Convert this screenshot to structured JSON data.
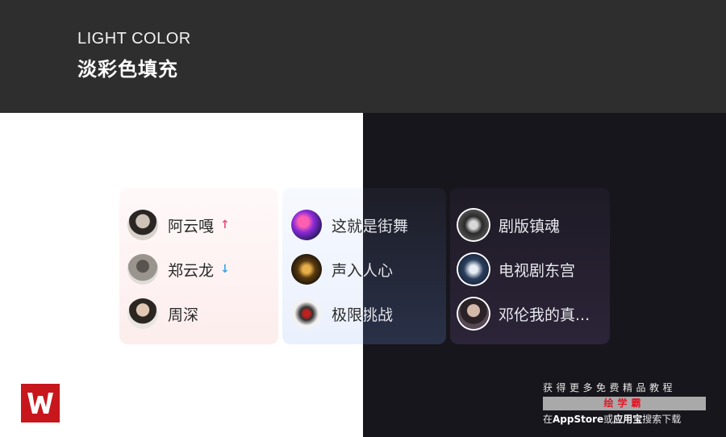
{
  "header": {
    "subtitle": "LIGHT COLOR",
    "title": "淡彩色填充"
  },
  "colors": {
    "header_bg": "#2e2e2e",
    "dark_bg": "#17161c",
    "arrow_up": "#e8507a",
    "arrow_down": "#3aa6e8",
    "logo_red": "#c8161d"
  },
  "list1": [
    {
      "name": "阿云嘎",
      "trend": "↑",
      "icon": "avatar-photo"
    },
    {
      "name": "郑云龙",
      "trend": "↓",
      "icon": "avatar-photo"
    },
    {
      "name": "周深",
      "trend": "",
      "icon": "avatar-photo"
    }
  ],
  "list2": [
    {
      "name": "这就是街舞",
      "icon": "show-cover"
    },
    {
      "name": "声入人心",
      "icon": "show-cover"
    },
    {
      "name": "极限挑战",
      "icon": "show-cover"
    }
  ],
  "list3": [
    {
      "name": "剧版镇魂",
      "icon": "show-cover"
    },
    {
      "name": "电视剧东宫",
      "icon": "show-cover"
    },
    {
      "name": "邓伦我的真...",
      "icon": "avatar-photo"
    }
  ],
  "promo": {
    "line1": "获得更多免费精品教程",
    "brand": "绘学霸",
    "line3_a": "在",
    "line3_b": "AppStore",
    "line3_c": "或",
    "line3_d": "应用宝",
    "line3_e": "搜索下载"
  }
}
